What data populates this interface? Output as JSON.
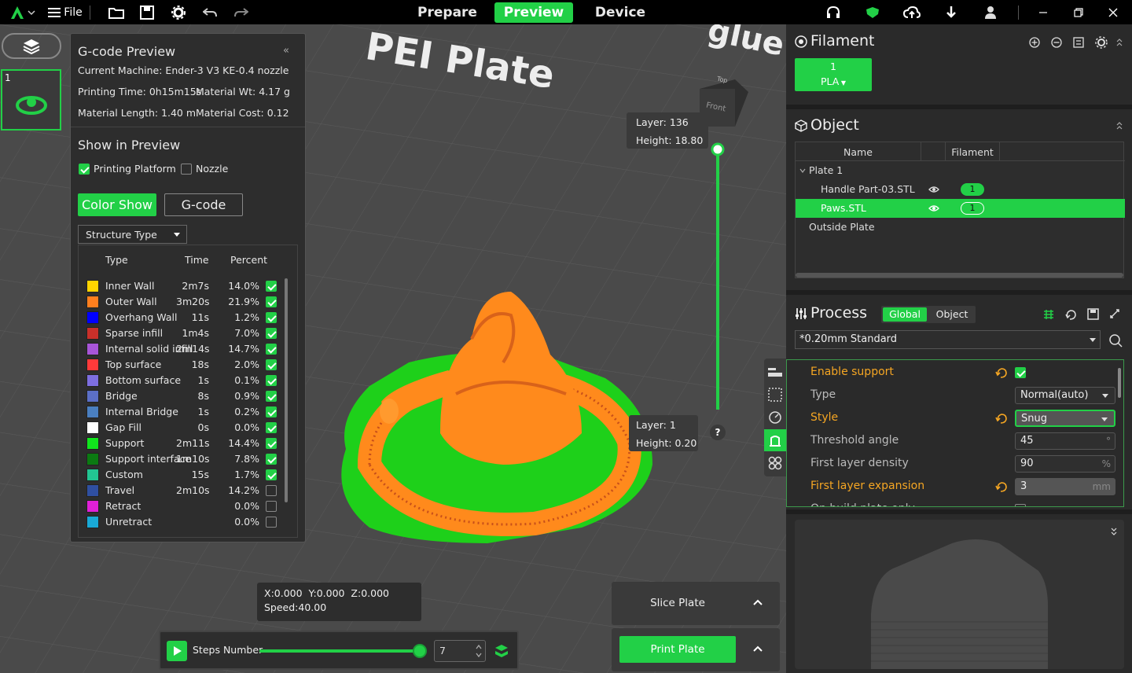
{
  "topbar": {
    "file_label": "File",
    "tabs": [
      {
        "label": "Prepare"
      },
      {
        "label": "Preview"
      },
      {
        "label": "Device"
      }
    ]
  },
  "plate_list": {
    "index": "1"
  },
  "gcode_preview": {
    "title": "G-code Preview",
    "collapse": "«",
    "machine": "Current Machine: Ender-3 V3 KE-0.4 nozzle",
    "printing_time": "Printing Time: 0h15m15s",
    "material_wt": "Material Wt: 4.17 g",
    "material_length": "Material Length: 1.40 m",
    "material_cost": "Material Cost: 0.12",
    "show_title": "Show in Preview",
    "printing_platform": "Printing Platform",
    "nozzle": "Nozzle",
    "color_show": "Color Show",
    "gcode": "G-code",
    "structure_type": "Structure Type",
    "headers": {
      "type": "Type",
      "time": "Time",
      "percent": "Percent"
    },
    "rows": [
      {
        "color": "#ffd400",
        "type": "Inner Wall",
        "time": "2m7s",
        "percent": "14.0%",
        "checked": true
      },
      {
        "color": "#ff7f1e",
        "type": "Outer Wall",
        "time": "3m20s",
        "percent": "21.9%",
        "checked": true
      },
      {
        "color": "#0000ff",
        "type": "Overhang Wall",
        "time": "11s",
        "percent": "1.2%",
        "checked": true
      },
      {
        "color": "#c8302a",
        "type": "Sparse infill",
        "time": "1m4s",
        "percent": "7.0%",
        "checked": true
      },
      {
        "color": "#a855d8",
        "type": "Internal solid infill",
        "time": "2m14s",
        "percent": "14.7%",
        "checked": true
      },
      {
        "color": "#ff3a3a",
        "type": "Top surface",
        "time": "18s",
        "percent": "2.0%",
        "checked": true
      },
      {
        "color": "#7d6ee0",
        "type": "Bottom surface",
        "time": "1s",
        "percent": "0.1%",
        "checked": true
      },
      {
        "color": "#5b6fc7",
        "type": "Bridge",
        "time": "8s",
        "percent": "0.9%",
        "checked": true
      },
      {
        "color": "#4a7fc0",
        "type": "Internal Bridge",
        "time": "1s",
        "percent": "0.2%",
        "checked": true
      },
      {
        "color": "#ffffff",
        "type": "Gap Fill",
        "time": "0s",
        "percent": "0.0%",
        "checked": true
      },
      {
        "color": "#11e61d",
        "type": "Support",
        "time": "2m11s",
        "percent": "14.4%",
        "checked": true
      },
      {
        "color": "#0b7a12",
        "type": "Support interface",
        "time": "1m10s",
        "percent": "7.8%",
        "checked": true
      },
      {
        "color": "#22c592",
        "type": "Custom",
        "time": "15s",
        "percent": "1.7%",
        "checked": true
      },
      {
        "color": "#2f4fa0",
        "type": "Travel",
        "time": "2m10s",
        "percent": "14.2%",
        "checked": false
      },
      {
        "color": "#e020d8",
        "type": "Retract",
        "time": "",
        "percent": "0.0%",
        "checked": false
      },
      {
        "color": "#19a9d6",
        "type": "Unretract",
        "time": "",
        "percent": "0.0%",
        "checked": false
      }
    ]
  },
  "scene": {
    "plate_text": "PEI Plate",
    "glue_text": "glue",
    "cube_top": "Top",
    "cube_front": "Front",
    "layer_top": "Layer: 136",
    "height_top": "Height: 18.80",
    "layer_bottom": "Layer: 1",
    "height_bottom": "Height: 0.20",
    "help": "?",
    "coords": "X:0.000  Y:0.000  Z:0.000",
    "speed": "Speed:40.00",
    "steps_label": "Steps Number",
    "steps_value": "7",
    "slice_plate": "Slice Plate",
    "print_plate": "Print Plate",
    "steps_progress": 0.97
  },
  "filament": {
    "title": "Filament",
    "slot_number": "1",
    "slot_type": "PLA"
  },
  "object": {
    "title": "Object",
    "col_name": "Name",
    "col_filament": "Filament",
    "plate": "Plate 1",
    "items": [
      {
        "name": "Handle Part-03.STL",
        "filament": "1",
        "selected": false
      },
      {
        "name": "Paws.STL",
        "filament": "1",
        "selected": true
      }
    ],
    "outside": "Outside Plate"
  },
  "process": {
    "title": "Process",
    "global": "Global",
    "object": "Object",
    "preset": "*0.20mm Standard",
    "params": [
      {
        "label": "Enable support",
        "value": "",
        "kind": "check",
        "modified": true
      },
      {
        "label": "Type",
        "value": "Normal(auto)",
        "kind": "select",
        "modified": false
      },
      {
        "label": "Style",
        "value": "Snug",
        "kind": "select",
        "modified": true
      },
      {
        "label": "Threshold angle",
        "value": "45",
        "unit": "°",
        "kind": "input",
        "modified": false
      },
      {
        "label": "First layer density",
        "value": "90",
        "unit": "%",
        "kind": "input",
        "modified": false
      },
      {
        "label": "First layer expansion",
        "value": "3",
        "unit": "mm",
        "kind": "input",
        "modified": true
      },
      {
        "label": "On build plate only",
        "value": "",
        "kind": "check",
        "modified": false
      }
    ]
  },
  "colors": {
    "accent": "#22d047",
    "modified": "#f5a623"
  }
}
